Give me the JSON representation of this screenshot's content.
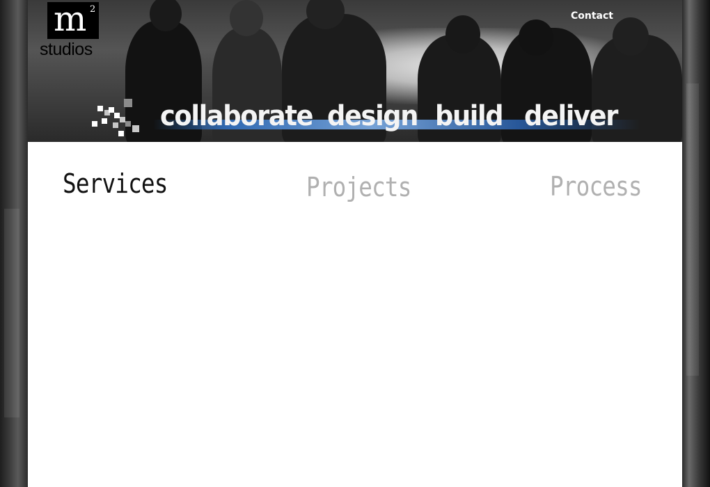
{
  "brand": {
    "logo_letter": "m",
    "logo_superscript": "2",
    "logo_word": "studios"
  },
  "header": {
    "contact_label": "Contact"
  },
  "tagline": {
    "words": [
      "collaborate",
      "design",
      "build",
      "deliver"
    ]
  },
  "nav": {
    "items": [
      {
        "label": "Services",
        "state": "active"
      },
      {
        "label": "Projects",
        "state": "inactive"
      },
      {
        "label": "Process",
        "state": "inactive"
      }
    ]
  },
  "colors": {
    "nav_active": "#111111",
    "nav_inactive": "#b0b0b0",
    "accent_stripe": "#2f6fc0",
    "content_bg": "#ffffff"
  }
}
